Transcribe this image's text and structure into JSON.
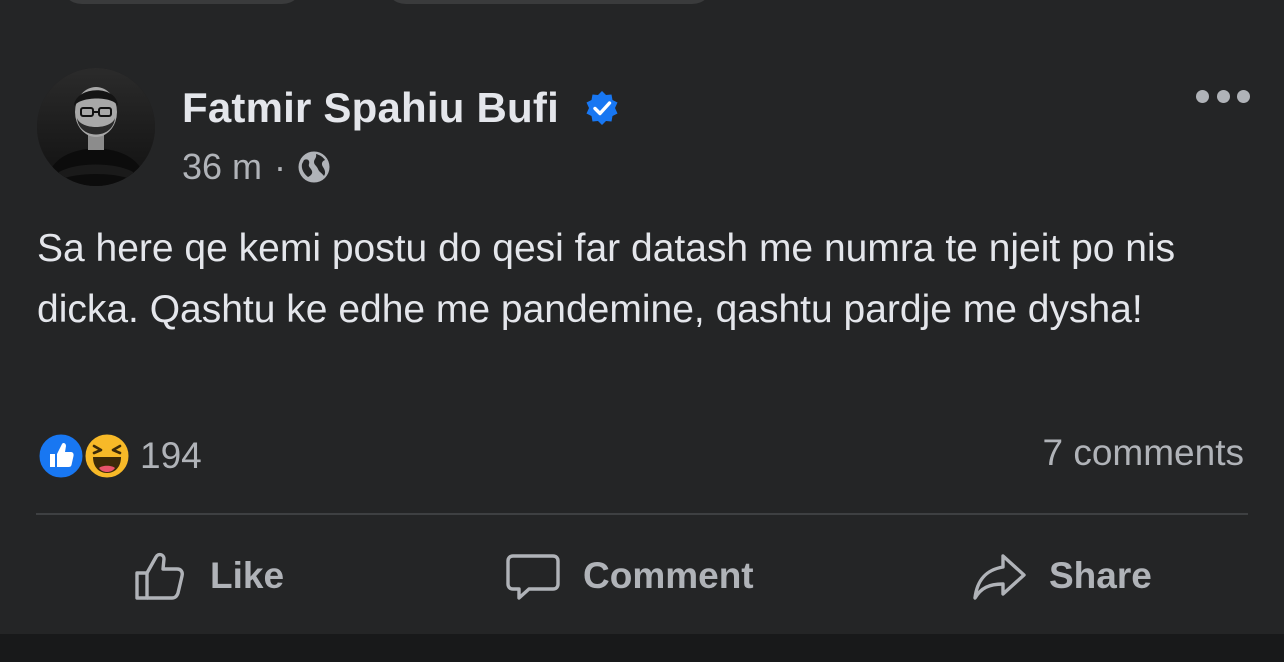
{
  "post": {
    "author": "Fatmir Spahiu Bufi",
    "verified": true,
    "time": "36 m",
    "separator": "·",
    "privacy_icon": "globe-icon",
    "text": "Sa here qe kemi postu do qesi far datash me numra te njeit po nis dicka. Qashtu ke edhe me pandemine, qashtu pardje me dysha!",
    "reactions": {
      "types": [
        "like",
        "haha"
      ],
      "count": "194"
    },
    "comments_label": "7 comments",
    "actions": {
      "like": "Like",
      "comment": "Comment",
      "share": "Share"
    }
  },
  "colors": {
    "background": "#242526",
    "text_primary": "#e4e6eb",
    "text_secondary": "#b0b3b8",
    "verified_blue": "#1877f2",
    "like_blue": "#1877f2",
    "haha_yellow": "#f7b928"
  }
}
